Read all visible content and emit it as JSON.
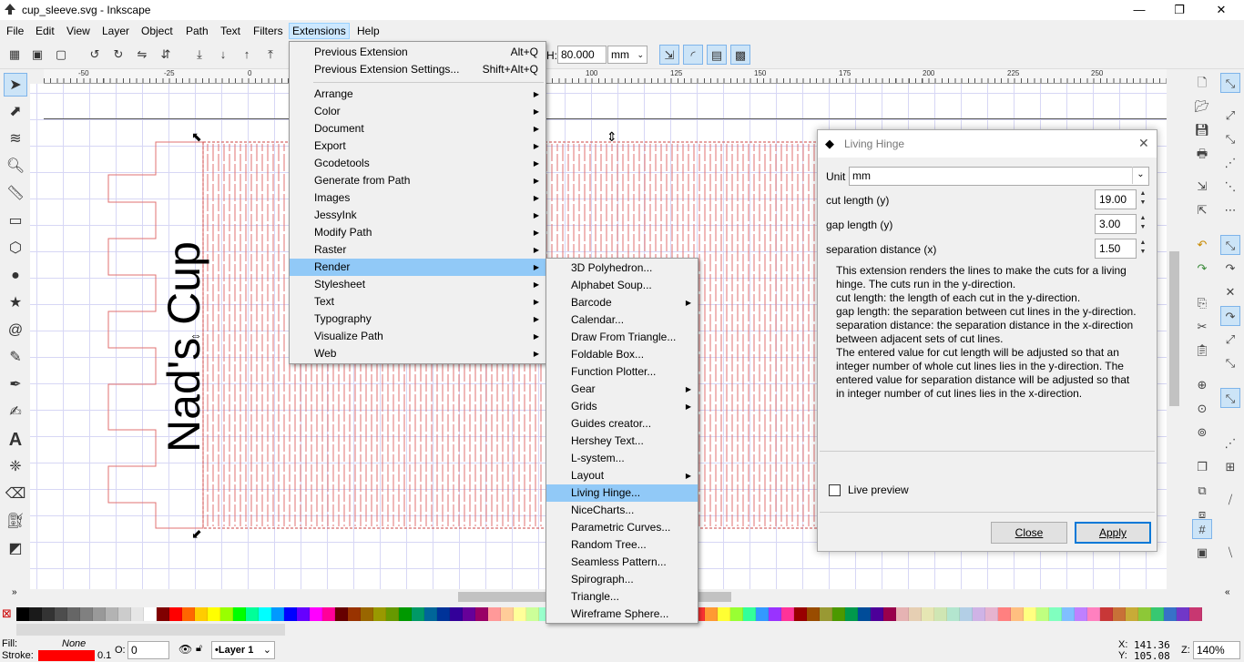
{
  "window": {
    "title": "cup_sleeve.svg - Inkscape",
    "minimize": "—",
    "maximize": "❐",
    "close": "✕"
  },
  "menubar": {
    "items": [
      "File",
      "Edit",
      "View",
      "Layer",
      "Object",
      "Path",
      "Text",
      "Filters",
      "Extensions",
      "Help"
    ],
    "active": "Extensions"
  },
  "toolbar": {
    "h_label": "H:",
    "h_value": "80.000",
    "unit": "mm"
  },
  "ruler": {
    "h_ticks": [
      "-50",
      "-25",
      "0",
      "25",
      "50",
      "75",
      "100",
      "125",
      "150",
      "175",
      "200",
      "225",
      "250"
    ],
    "v_ticks": [
      "0",
      "25",
      "50",
      "75"
    ]
  },
  "canvas": {
    "text": "Nad's Cup"
  },
  "extensions_menu": {
    "items": [
      {
        "label": "Previous Extension",
        "shortcut": "Alt+Q"
      },
      {
        "label": "Previous Extension Settings...",
        "shortcut": "Shift+Alt+Q"
      },
      {
        "label": "Arrange",
        "submenu": true
      },
      {
        "label": "Color",
        "submenu": true
      },
      {
        "label": "Document",
        "submenu": true
      },
      {
        "label": "Export",
        "submenu": true
      },
      {
        "label": "Gcodetools",
        "submenu": true
      },
      {
        "label": "Generate from Path",
        "submenu": true
      },
      {
        "label": "Images",
        "submenu": true
      },
      {
        "label": "JessyInk",
        "submenu": true
      },
      {
        "label": "Modify Path",
        "submenu": true
      },
      {
        "label": "Raster",
        "submenu": true
      },
      {
        "label": "Render",
        "submenu": true,
        "highlighted": true
      },
      {
        "label": "Stylesheet",
        "submenu": true
      },
      {
        "label": "Text",
        "submenu": true
      },
      {
        "label": "Typography",
        "submenu": true
      },
      {
        "label": "Visualize Path",
        "submenu": true
      },
      {
        "label": "Web",
        "submenu": true
      }
    ]
  },
  "render_menu": {
    "items": [
      {
        "label": "3D Polyhedron..."
      },
      {
        "label": "Alphabet Soup..."
      },
      {
        "label": "Barcode",
        "submenu": true
      },
      {
        "label": "Calendar..."
      },
      {
        "label": "Draw From Triangle..."
      },
      {
        "label": "Foldable Box..."
      },
      {
        "label": "Function Plotter..."
      },
      {
        "label": "Gear",
        "submenu": true
      },
      {
        "label": "Grids",
        "submenu": true
      },
      {
        "label": "Guides creator..."
      },
      {
        "label": "Hershey Text..."
      },
      {
        "label": "L-system..."
      },
      {
        "label": "Layout",
        "submenu": true
      },
      {
        "label": "Living Hinge...",
        "highlighted": true
      },
      {
        "label": "NiceCharts..."
      },
      {
        "label": "Parametric Curves..."
      },
      {
        "label": "Random Tree..."
      },
      {
        "label": "Seamless Pattern..."
      },
      {
        "label": "Spirograph..."
      },
      {
        "label": "Triangle..."
      },
      {
        "label": "Wireframe Sphere..."
      }
    ]
  },
  "dialog": {
    "title": "Living Hinge",
    "close_icon": "✕",
    "unit_label": "Unit",
    "unit_value": "mm",
    "cut_length_label": "cut length (y)",
    "cut_length_value": "19.00",
    "gap_length_label": "gap length (y)",
    "gap_length_value": "3.00",
    "separation_label": "separation distance (x)",
    "separation_value": "1.50",
    "description": [
      "This extension renders the lines to make the cuts for a living",
      "hinge. The cuts run in the y-direction.",
      "cut length: the length of each cut in the y-direction.",
      "gap length: the separation between cut lines in the y-direction.",
      "separation distance: the separation distance in the x-direction",
      "between adjacent sets of cut lines.",
      "The entered value for cut length will be adjusted so that an",
      "integer number of whole cut lines lies in the y-direction. The",
      "entered value for separation distance will be adjusted so that",
      "in integer number of cut lines lies in the x-direction."
    ],
    "live_preview_label": "Live preview",
    "close_button": "Close",
    "apply_button": "Apply"
  },
  "palette": {
    "colors": [
      "#000000",
      "#1a1a1a",
      "#333333",
      "#4d4d4d",
      "#666666",
      "#808080",
      "#999999",
      "#b3b3b3",
      "#cccccc",
      "#e6e6e6",
      "#ffffff",
      "#800000",
      "#ff0000",
      "#ff6600",
      "#ffcc00",
      "#ffff00",
      "#99ff00",
      "#00ff00",
      "#00ff99",
      "#00ffff",
      "#0099ff",
      "#0000ff",
      "#6600ff",
      "#ff00ff",
      "#ff0099",
      "#660000",
      "#993300",
      "#996600",
      "#999900",
      "#669900",
      "#009900",
      "#009966",
      "#006699",
      "#003399",
      "#330099",
      "#660099",
      "#990066",
      "#ff9999",
      "#ffcc99",
      "#ffff99",
      "#ccff99",
      "#99ffcc",
      "#99ccff",
      "#cc99ff",
      "#ff99cc",
      "#cc0000",
      "#cc6600",
      "#cccc00",
      "#66cc00",
      "#00cc66",
      "#0066cc",
      "#6600cc",
      "#cc0066",
      "#ff3333",
      "#ff9933",
      "#ffff33",
      "#99ff33",
      "#33ff99",
      "#3399ff",
      "#9933ff",
      "#ff3399",
      "#990000",
      "#994c00",
      "#999933",
      "#4c9900",
      "#00994c",
      "#004c99",
      "#4c0099",
      "#99004c",
      "#e6b3b3",
      "#e6cfb3",
      "#e6e6b3",
      "#cfe6b3",
      "#b3e6cf",
      "#b3cfe6",
      "#cfb3e6",
      "#e6b3cf",
      "#ff8080",
      "#ffbf80",
      "#ffff80",
      "#bfff80",
      "#80ffbf",
      "#80bfff",
      "#bf80ff",
      "#ff80bf",
      "#c83737",
      "#c87137",
      "#c8ab37",
      "#8dc837",
      "#37c871",
      "#3771c8",
      "#7137c8",
      "#c83771"
    ]
  },
  "status": {
    "fill_label": "Fill:",
    "fill_value": "None",
    "stroke_label": "Stroke:",
    "stroke_color": "#ff0000",
    "stroke_width": "0.1",
    "opacity_label": "O:",
    "opacity_value": "0",
    "layer_value": "•Layer 1",
    "x_label": "X:",
    "x_value": "141.36",
    "y_label": "Y:",
    "y_value": "105.08",
    "z_label": "Z:",
    "zoom_value": "140%"
  }
}
